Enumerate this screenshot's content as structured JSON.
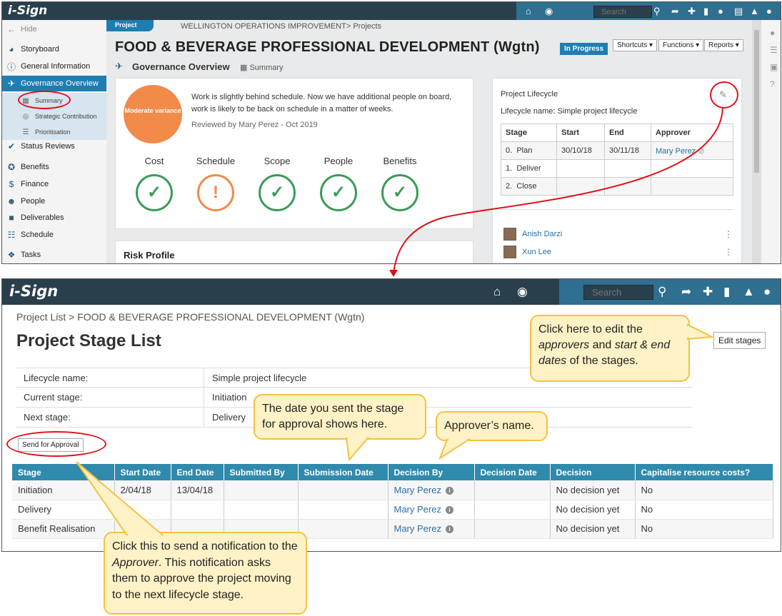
{
  "top": {
    "logo": "i-Sign",
    "search_placeholder": "Search",
    "sidebar": {
      "hide": "Hide",
      "items": [
        {
          "label": "Storyboard",
          "icon": "palette-icon"
        },
        {
          "label": "General Information",
          "icon": "info-icon"
        },
        {
          "label": "Governance Overview",
          "icon": "helicopter-icon"
        },
        {
          "label": "Summary",
          "icon": "grid-icon"
        },
        {
          "label": "Strategic Contribution",
          "icon": "target-icon"
        },
        {
          "label": "Prioritisation",
          "icon": "list-icon"
        },
        {
          "label": "Status Reviews",
          "icon": "check-icon"
        },
        {
          "label": "Benefits",
          "icon": "ribbon-icon"
        },
        {
          "label": "Finance",
          "icon": "dollar-icon"
        },
        {
          "label": "People",
          "icon": "people-icon"
        },
        {
          "label": "Deliverables",
          "icon": "truck-icon"
        },
        {
          "label": "Schedule",
          "icon": "schedule-icon"
        },
        {
          "label": "Tasks",
          "icon": "cubes-icon"
        }
      ]
    },
    "project_tag": "Project",
    "breadcrumb": "WELLINGTON OPERATIONS IMPROVEMENT> Projects",
    "title": "FOOD & BEVERAGE PROFESSIONAL DEVELOPMENT (Wgtn)",
    "status_badge": "In Progress",
    "buttons": {
      "shortcuts": "Shortcuts ▾",
      "functions": "Functions ▾",
      "reports": "Reports ▾"
    },
    "subtitle": "Governance Overview",
    "subtitle_view": "Summary",
    "variance": "Moderate variance",
    "status_text": "Work is slightly behind schedule. Now we have additional people on board, work is likely to be back on schedule in a matter of weeks.",
    "reviewed": "Reviewed by Mary Perez - Oct 2019",
    "metrics": [
      {
        "label": "Cost",
        "state": "ok"
      },
      {
        "label": "Schedule",
        "state": "warn"
      },
      {
        "label": "Scope",
        "state": "ok"
      },
      {
        "label": "People",
        "state": "ok"
      },
      {
        "label": "Benefits",
        "state": "ok"
      }
    ],
    "risk_profile": "Risk Profile",
    "lifecycle": {
      "title": "Project Lifecycle",
      "name": "Lifecycle name: Simple project lifecycle",
      "headers": [
        "Stage",
        "Start",
        "End",
        "Approver"
      ],
      "rows": [
        {
          "idx": "0.",
          "stage": "Plan",
          "start": "30/10/18",
          "end": "30/11/18",
          "approver": "Mary Perez"
        },
        {
          "idx": "1.",
          "stage": "Deliver",
          "start": "",
          "end": "",
          "approver": ""
        },
        {
          "idx": "2.",
          "stage": "Close",
          "start": "",
          "end": "",
          "approver": ""
        }
      ]
    },
    "people": [
      "Anish Darzi",
      "Xun Lee"
    ]
  },
  "bottom": {
    "logo": "i-Sign",
    "search_placeholder": "Search",
    "breadcrumb": "Project List > FOOD & BEVERAGE PROFESSIONAL DEVELOPMENT (Wgtn)",
    "title": "Project Stage List",
    "edit_button": "Edit stages",
    "info": [
      {
        "key": "Lifecycle name:",
        "value": "Simple project lifecycle"
      },
      {
        "key": "Current stage:",
        "value": "Initiation"
      },
      {
        "key": "Next stage:",
        "value": "Delivery"
      }
    ],
    "send_button": "Send for Approval",
    "table": {
      "headers": [
        "Stage",
        "Start Date",
        "End Date",
        "Submitted By",
        "Submission Date",
        "Decision By",
        "Decision Date",
        "Decision",
        "Capitalise resource costs?"
      ],
      "rows": [
        {
          "stage": "Initiation",
          "start": "2/04/18",
          "end": "13/04/18",
          "submitted_by": "",
          "submission_date": "",
          "decision_by": "Mary Perez",
          "decision_date": "",
          "decision": "No decision yet",
          "capitalise": "No"
        },
        {
          "stage": "Delivery",
          "start": "",
          "end": "",
          "submitted_by": "",
          "submission_date": "",
          "decision_by": "Mary Perez",
          "decision_date": "",
          "decision": "No decision yet",
          "capitalise": "No"
        },
        {
          "stage": "Benefit Realisation",
          "start": "",
          "end": "",
          "submitted_by": "",
          "submission_date": "",
          "decision_by": "Mary Perez",
          "decision_date": "",
          "decision": "No decision yet",
          "capitalise": "No"
        }
      ]
    }
  },
  "callouts": {
    "edit": {
      "pre": "Click here to edit the ",
      "em1": "approvers",
      "mid": " and ",
      "em2": "start & end dates",
      "post": " of the stages."
    },
    "date": "The date you sent the stage for approval shows here.",
    "approver": "Approver’s name.",
    "send": {
      "pre": "Click this to send a notification to the ",
      "em": "Approver",
      "post": ". This notification asks them to approve the project moving to the next lifecycle stage."
    }
  },
  "colors": {
    "accent": "#1f7eb0",
    "nav": "#2a3f4c",
    "annotation": "#e0101a",
    "callout_fill": "#fff2c6",
    "callout_border": "#f5c242",
    "ok": "#3a9a58",
    "warn": "#f28a4a"
  }
}
